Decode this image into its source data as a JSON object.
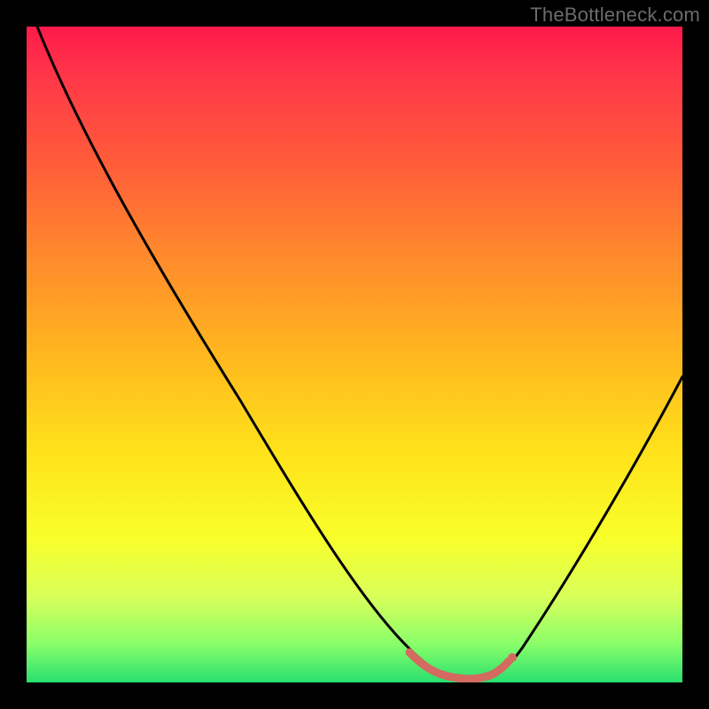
{
  "watermark": "TheBottleneck.com",
  "chart_data": {
    "type": "line",
    "title": "",
    "xlabel": "",
    "ylabel": "",
    "xlim": [
      0,
      100
    ],
    "ylim": [
      0,
      100
    ],
    "grid": false,
    "legend": false,
    "background_gradient": {
      "orientation": "vertical",
      "stops": [
        {
          "pos": 0.0,
          "color": "#ff1a4b"
        },
        {
          "pos": 0.5,
          "color": "#ffb71f"
        },
        {
          "pos": 0.78,
          "color": "#f8ff2a"
        },
        {
          "pos": 1.0,
          "color": "#28e06e"
        }
      ]
    },
    "series": [
      {
        "name": "bottleneck-curve",
        "color": "#000000",
        "x": [
          0,
          5,
          10,
          15,
          20,
          25,
          30,
          35,
          40,
          45,
          50,
          55,
          60,
          62,
          65,
          70,
          72,
          75,
          80,
          85,
          90,
          95,
          100
        ],
        "values": [
          100,
          93,
          86,
          79,
          72,
          65,
          57,
          49,
          41,
          33,
          25,
          17,
          9,
          5,
          2,
          0,
          0,
          2,
          9,
          20,
          33,
          45,
          58
        ]
      },
      {
        "name": "highlight-band",
        "color": "#d46a60",
        "x": [
          58,
          62,
          66,
          70,
          73
        ],
        "values": [
          4,
          2,
          1,
          1,
          3
        ]
      }
    ],
    "annotations": []
  }
}
